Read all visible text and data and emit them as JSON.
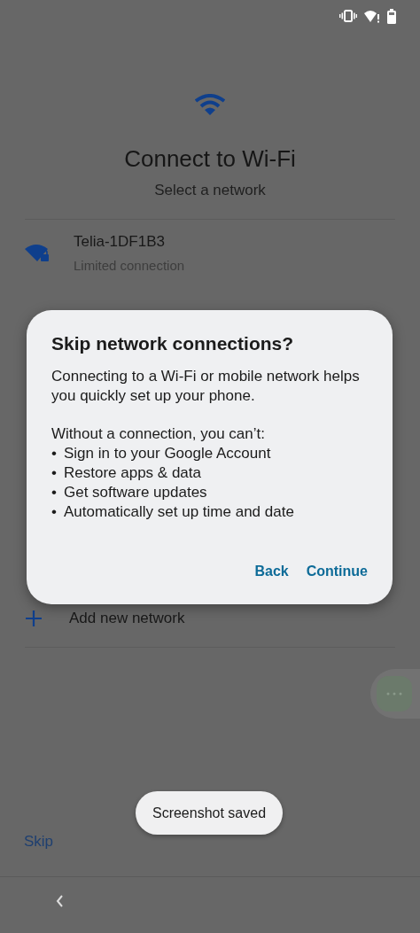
{
  "header": {
    "title": "Connect to Wi-Fi",
    "subtitle": "Select a network"
  },
  "networks": [
    {
      "name": "Telia-1DF1B3",
      "status": "Limited connection"
    }
  ],
  "add_network": {
    "label": "Add new network"
  },
  "skip": {
    "label": "Skip"
  },
  "dialog": {
    "title": "Skip network connections?",
    "intro": "Connecting to a Wi-Fi or mobile network helps you quickly set up your phone.",
    "list_heading": "Without a connection, you can’t:",
    "items": [
      {
        "bullet": "•",
        "text": "Sign in to your Google Account"
      },
      {
        "bullet": "•",
        "text": "Restore apps & data"
      },
      {
        "bullet": "•",
        "text": "Get software updates"
      },
      {
        "bullet": "•",
        "text": "Automatically set up time and date"
      }
    ],
    "buttons": [
      {
        "label": "Back"
      },
      {
        "label": "Continue"
      }
    ]
  },
  "toast": {
    "text": "Screenshot saved"
  }
}
